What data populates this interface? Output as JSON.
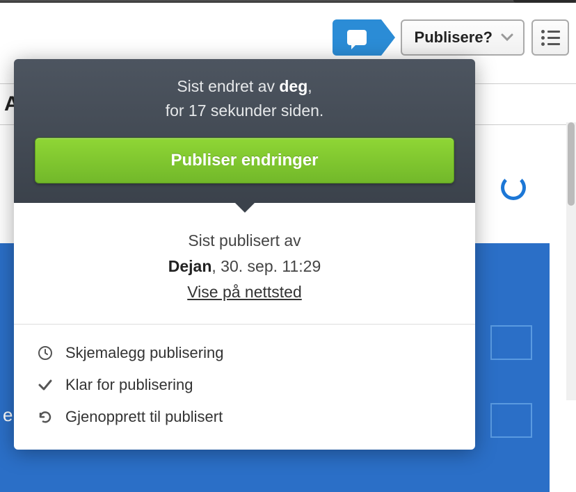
{
  "toolbar": {
    "publish_label": "Publisere?"
  },
  "popover": {
    "last_edited_prefix": "Sist endret av ",
    "last_edited_by": "deg",
    "last_edited_suffix": ",",
    "last_edited_time": "for 17 sekunder siden.",
    "publish_changes_label": "Publiser endringer",
    "last_published_prefix": "Sist publisert av",
    "last_published_by": "Dejan",
    "last_published_separator": ", ",
    "last_published_time": "30. sep. 11:29",
    "view_on_site_label": "Vise på nettsted",
    "actions": {
      "schedule": "Skjemalegg publisering",
      "ready": "Klar for publisering",
      "revert": "Gjenopprett til publisert"
    }
  },
  "page": {
    "header_letter": "A",
    "edge_letter": "e"
  }
}
